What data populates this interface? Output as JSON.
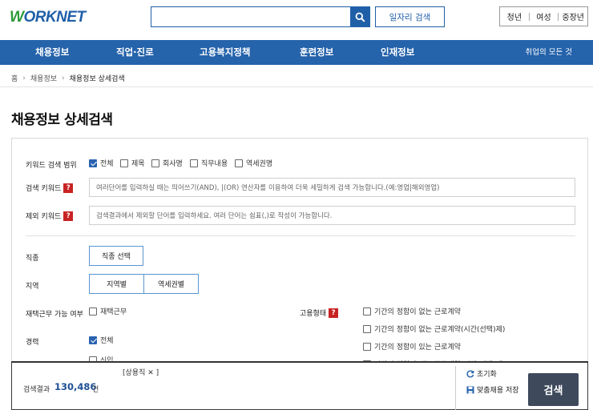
{
  "header": {
    "logo": "WORKNET",
    "search_value": "",
    "job_search_label": "일자리 검색",
    "segments": [
      "청년",
      "여성",
      "중장년"
    ]
  },
  "nav": {
    "items": [
      "채용정보",
      "직업·진로",
      "고용복지정책",
      "훈련정보",
      "인재정보"
    ],
    "all_services": "취업의 모든 것"
  },
  "breadcrumb": [
    "홈",
    "채용정보",
    "채용정보 상세검색"
  ],
  "page_title": "채용정보 상세검색",
  "form": {
    "keyword_scope": {
      "label": "키워드 검색 범위",
      "options": [
        {
          "label": "전체",
          "checked": true
        },
        {
          "label": "제목",
          "checked": false
        },
        {
          "label": "회사명",
          "checked": false
        },
        {
          "label": "직무내용",
          "checked": false
        },
        {
          "label": "역세권명",
          "checked": false
        }
      ]
    },
    "search_keyword": {
      "label": "검색 키워드",
      "placeholder": "여러단어를 입력하실 때는 띄어쓰기(AND), |(OR) 연산자를 이용하여 더욱 세밀하게 검색 가능합니다.(예:영업|해외영업)"
    },
    "exclude_keyword": {
      "label": "제외 키워드",
      "placeholder": "검색결과에서 제외할 단어를 입력하세요. 여러 단어는 쉼표(,)로 작성이 가능합니다."
    },
    "job_type": {
      "label": "직종",
      "button": "직종 선택"
    },
    "region": {
      "label": "지역",
      "buttons": [
        "지역별",
        "역세권별"
      ]
    },
    "remote": {
      "label": "재택근무 가능 여부",
      "option": "재택근무",
      "checked": false
    },
    "career": {
      "label": "경력",
      "options": [
        {
          "label": "전체",
          "checked": true
        },
        {
          "label": "신입",
          "checked": false
        }
      ]
    },
    "employment_type": {
      "label": "고용형태",
      "options": [
        {
          "label": "기간의 정함이 없는 근로계약",
          "checked": false
        },
        {
          "label": "기간의 정함이 없는 근로계약(시간(선택)제)",
          "checked": false
        },
        {
          "label": "기간의 정함이 있는 근로계약",
          "checked": false
        },
        {
          "label": "기간의 정함이 있는 근로계약(시간(선택)제)",
          "checked": false
        }
      ]
    }
  },
  "result_bar": {
    "selected_tag": "[상용직 ✕ ]",
    "result_label": "검색결과",
    "result_count": "130,486",
    "result_unit": "건",
    "reset_label": "초기화",
    "save_label": "맞춤채용 저장",
    "search_label": "검색"
  },
  "colors": {
    "brand_blue": "#1f5fa8",
    "nav_blue": "#2563ab",
    "help_red": "#c82323",
    "search_button": "#3e4a5c"
  }
}
